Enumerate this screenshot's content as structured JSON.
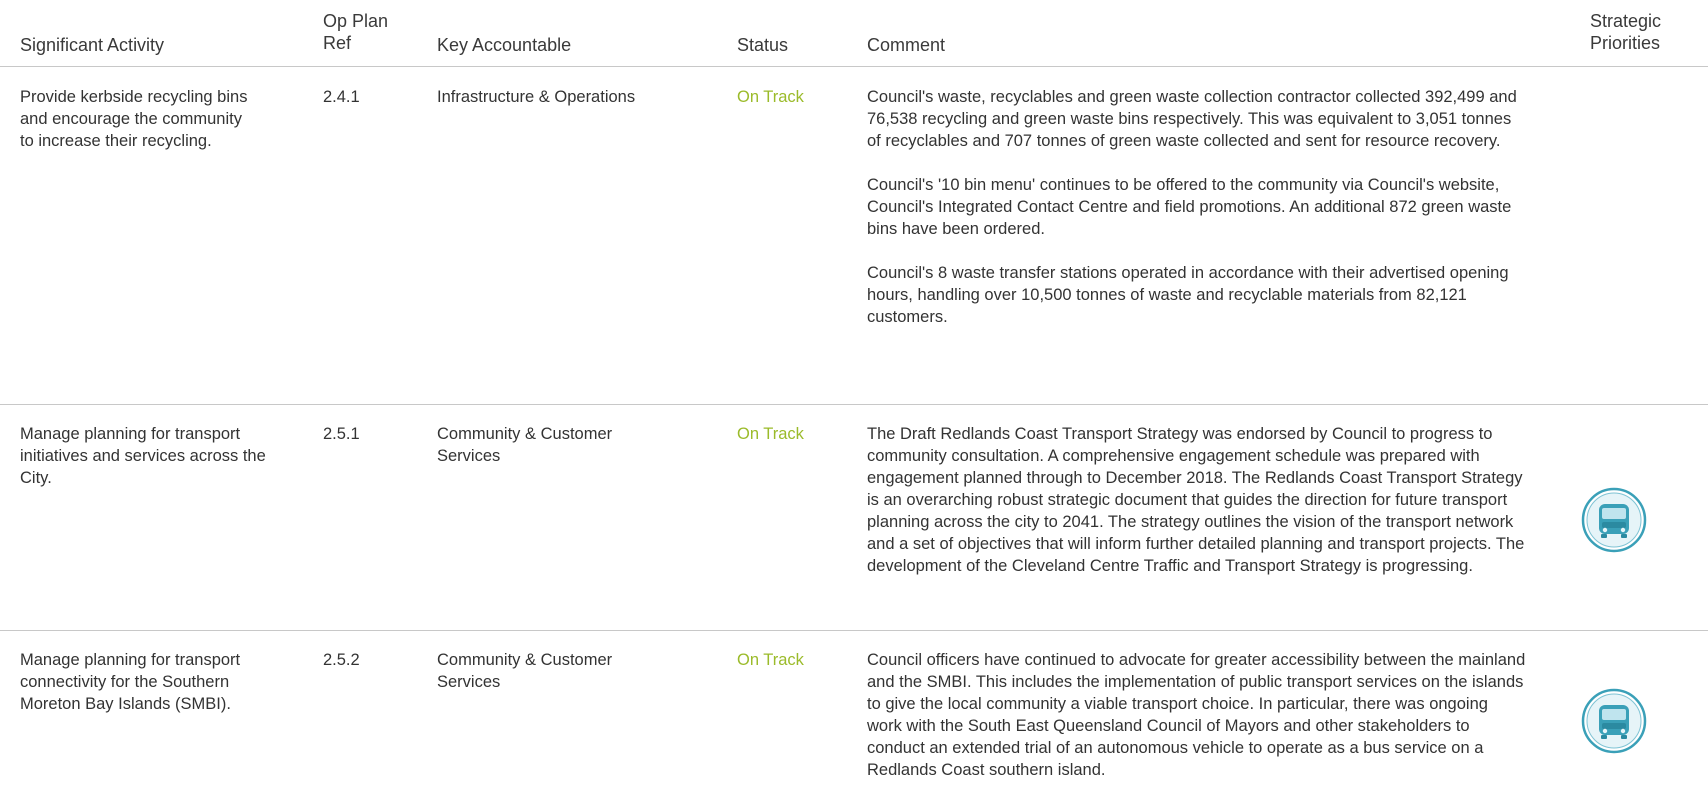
{
  "header": {
    "significant_activity": "Significant Activity",
    "op_plan_ref_line1": "Op Plan",
    "op_plan_ref_line2": "Ref",
    "key_accountable": "Key Accountable",
    "status": "Status",
    "comment": "Comment",
    "strategic_priorities_line1": "Strategic",
    "strategic_priorities_line2": "Priorities"
  },
  "rows": [
    {
      "activity": "Provide kerbside recycling bins and encourage the community to increase their recycling.",
      "ref": "2.4.1",
      "accountable": "Infrastructure & Operations",
      "status": "On Track",
      "comments": [
        "Council's waste, recyclables and green waste collection contractor collected 392,499 and 76,538 recycling and green waste bins respectively. This was equivalent to 3,051 tonnes of recyclables and 707 tonnes of green waste collected and sent for resource recovery.",
        "Council's '10 bin menu' continues to be offered to the community via Council's website, Council's Integrated Contact Centre and field promotions. An additional 872 green waste bins have been ordered.",
        "Council's 8 waste transfer stations operated in accordance with their advertised opening hours, handling over 10,500 tonnes of waste and recyclable materials from 82,121 customers."
      ],
      "priority_icon": ""
    },
    {
      "activity": "Manage planning for transport initiatives and services across the City.",
      "ref": "2.5.1",
      "accountable": "Community & Customer Services",
      "status": "On Track",
      "comments": [
        "The Draft Redlands Coast Transport Strategy was endorsed by Council to progress to community consultation. A comprehensive engagement schedule was prepared with engagement planned through to December 2018. The Redlands Coast Transport Strategy is an overarching robust strategic document that guides the direction for future transport planning across the city to 2041. The strategy outlines the vision of the transport network and a set of objectives that will inform further detailed planning and transport projects. The development of the Cleveland Centre Traffic and Transport Strategy is progressing."
      ],
      "priority_icon": "bus-icon"
    },
    {
      "activity": "Manage planning for transport connectivity for the Southern Moreton Bay Islands (SMBI).",
      "ref": "2.5.2",
      "accountable": "Community & Customer Services",
      "status": "On Track",
      "comments": [
        "Council officers have continued to advocate for greater accessibility between the mainland and the SMBI. This includes the implementation of public transport services on the islands to give the local community a viable transport choice. In particular, there was ongoing work with the South East Queensland Council of Mayors and other stakeholders to conduct an extended trial of an autonomous vehicle to operate as a bus service on a Redlands Coast southern island."
      ],
      "priority_icon": "bus-icon"
    }
  ],
  "colors": {
    "status_on_track": "#9bbb2a",
    "icon_teal": "#3aa0b8",
    "rule": "#c8c8c8"
  }
}
